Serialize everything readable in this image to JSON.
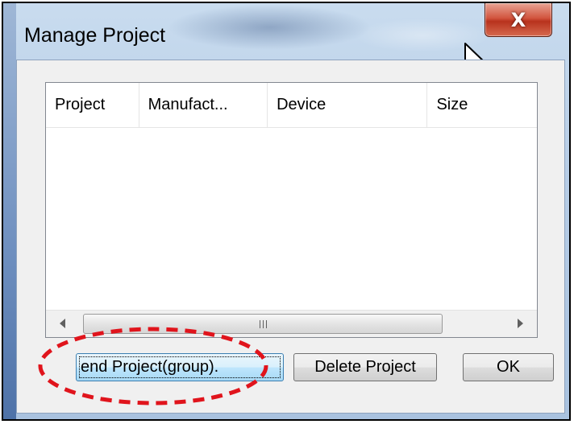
{
  "window": {
    "title": "Manage Project",
    "close_label": "X"
  },
  "listview": {
    "columns": [
      "Project",
      "Manufact...",
      "Device",
      "Size"
    ],
    "rows": [],
    "scrollbar_grip": "III"
  },
  "buttons": {
    "append_label": "end Project(group).",
    "delete_label": "Delete Project",
    "ok_label": "OK"
  },
  "colors": {
    "annotation": "#e0141c",
    "close_button": "#c7432b",
    "focus_button": "#bee6fd"
  },
  "icons": {
    "cursor": "mouse-pointer-icon",
    "close": "close-icon",
    "scroll_left": "chevron-left-icon",
    "scroll_right": "chevron-right-icon"
  }
}
